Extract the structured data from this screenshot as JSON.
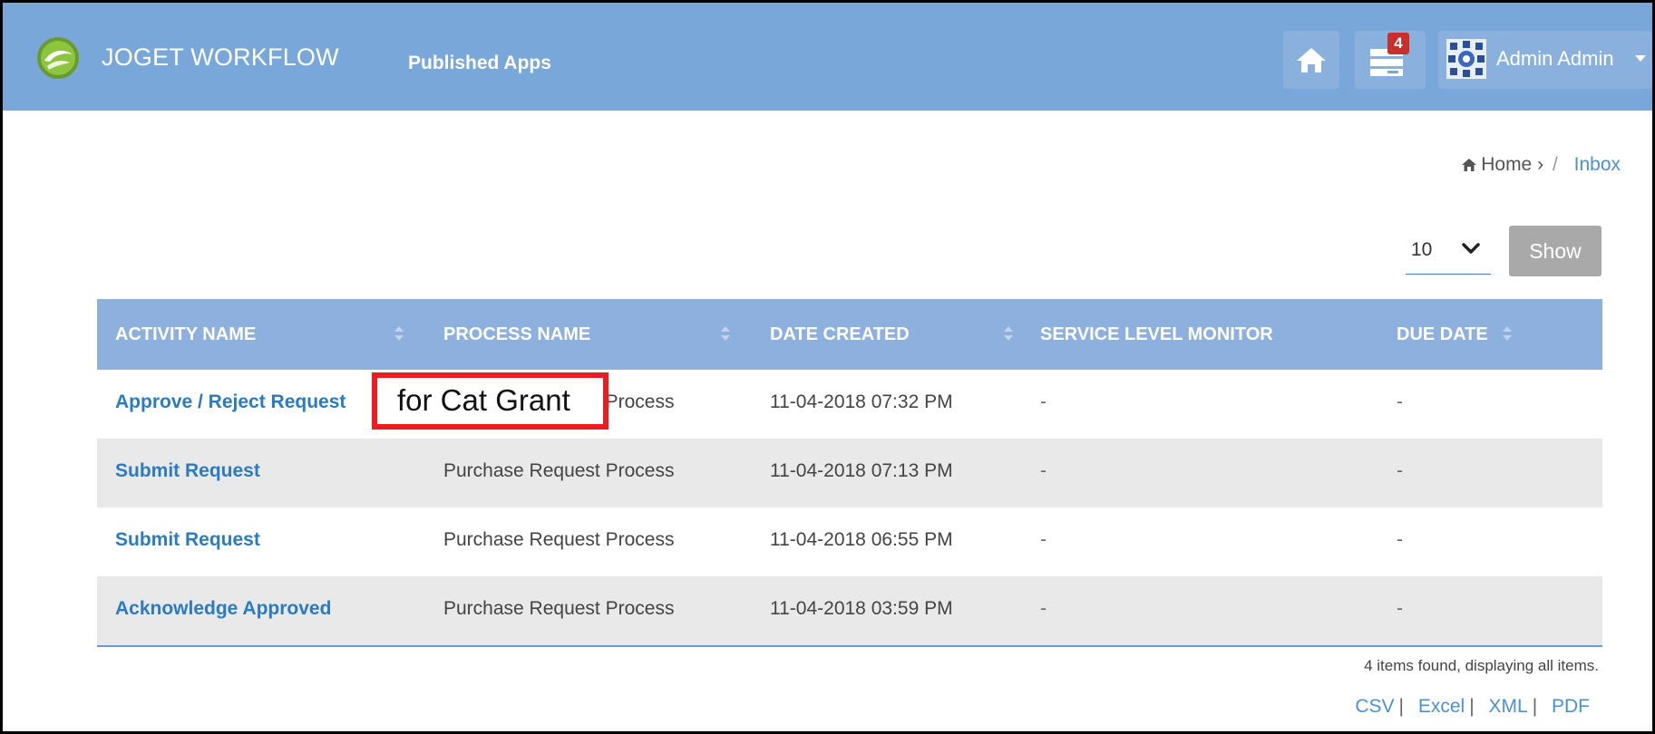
{
  "navbar": {
    "brand": "JOGET WORKFLOW",
    "link": "Published Apps",
    "inbox_count": "4",
    "user_name": "Admin Admin"
  },
  "breadcrumb": {
    "home": "Home",
    "separator_arrow": "›",
    "separator_slash": "/",
    "current": "Inbox"
  },
  "pagination": {
    "page_size": "10",
    "show_label": "Show"
  },
  "table": {
    "headers": [
      "ACTIVITY NAME",
      "PROCESS NAME",
      "DATE CREATED",
      "SERVICE LEVEL MONITOR",
      "DUE DATE"
    ],
    "rows": [
      {
        "activity": "Approve / Reject Request",
        "process": "Purchase Request Process",
        "date": "11-04-2018 07:32 PM",
        "slm": "-",
        "due": "-"
      },
      {
        "activity": "Submit Request",
        "process": "Purchase Request Process",
        "date": "11-04-2018 07:13 PM",
        "slm": "-",
        "due": "-"
      },
      {
        "activity": "Submit Request",
        "process": "Purchase Request Process",
        "date": "11-04-2018 06:55 PM",
        "slm": "-",
        "due": "-"
      },
      {
        "activity": "Acknowledge Approved",
        "process": "Purchase Request Process",
        "date": "11-04-2018 03:59 PM",
        "slm": "-",
        "due": "-"
      }
    ]
  },
  "footer": {
    "found_text": "4 items found, displaying all items.",
    "export_separator": "|",
    "exports": [
      "CSV",
      "Excel",
      "XML",
      "PDF"
    ]
  },
  "annotation": {
    "text": "for Cat Grant"
  },
  "colors": {
    "navbar": "#7aa7d9",
    "table_header": "#8db0de",
    "link": "#2b7bc4",
    "badge": "#c9302c",
    "annotation_border": "#ee1c1c"
  }
}
